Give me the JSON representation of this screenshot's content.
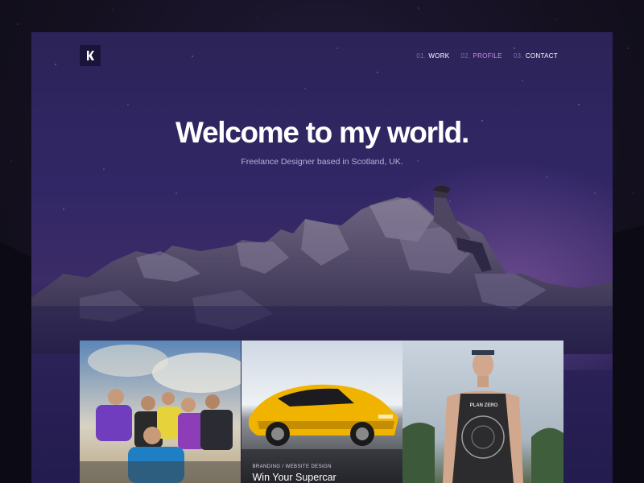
{
  "nav": {
    "items": [
      {
        "num": "01.",
        "label": "WORK"
      },
      {
        "num": "02.",
        "label": "PROFILE"
      },
      {
        "num": "03.",
        "label": "CONTACT"
      }
    ],
    "active_index": 1
  },
  "hero": {
    "title": "Welcome to my world.",
    "subtitle": "Freelance Designer based in Scotland, UK."
  },
  "portfolio": {
    "cards": [
      {
        "tag": "",
        "title": ""
      },
      {
        "tag": "BRANDING / WEBSITE DESIGN",
        "title": "Win Your Supercar"
      },
      {
        "tag": "",
        "title": ""
      }
    ]
  },
  "jersey_text": "PLAN ZERO",
  "colors": {
    "accent": "#c890e6",
    "hero_bg": "#322766",
    "page_bg": "#14101f",
    "car": "#f0b400"
  }
}
